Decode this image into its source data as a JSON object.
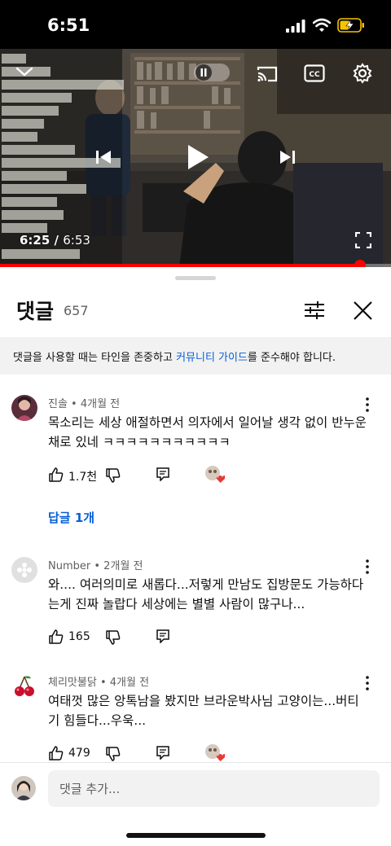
{
  "status_bar": {
    "time": "6:51"
  },
  "video": {
    "current_time": "6:25",
    "separator": " / ",
    "duration": "6:53",
    "progress": 0.92
  },
  "comments_panel": {
    "title": "댓글",
    "count": "657",
    "guideline_prefix": "댓글을 사용할 때는 타인을 존중하고 ",
    "guideline_link": "커뮤니티 가이드",
    "guideline_suffix": "를 준수해야 합니다."
  },
  "comments": [
    {
      "author": "진솔",
      "time": "4개월 전",
      "text": "목소리는 세상 애절하면서 의자에서 일어날 생각 없이 반누운채로 있네 ㅋㅋㅋㅋㅋㅋㅋㅋㅋㅋㅋ",
      "likes": "1.7천",
      "creator_heart": true,
      "replies_label": "답글 1개"
    },
    {
      "author": "Number",
      "time": "2개월 전",
      "text": "와.... 여러의미로 새롭다...저렇게 만남도 집방문도 가능하다는게 진짜 놀랍다 세상에는 별별 사람이 많구나...",
      "likes": "165",
      "creator_heart": false
    },
    {
      "author": "체리맛불닭",
      "time": "4개월 전",
      "text": "여태껏 많은 앙톡남을 봤지만 브라운박사님 고양이는...버티기 힘들다...우욱...",
      "likes": "479",
      "creator_heart": true
    }
  ],
  "meta_separator": " • ",
  "input": {
    "placeholder": "댓글 추가..."
  },
  "colors": {
    "accent_red": "#ff0000",
    "link_blue": "#065fd4",
    "muted_text": "#606060"
  },
  "icons": [
    "collapse-chevron-icon",
    "pause-icon",
    "cast-icon",
    "captions-icon",
    "settings-gear-icon",
    "previous-icon",
    "play-icon",
    "next-icon",
    "fullscreen-icon",
    "filter-icon",
    "close-icon",
    "like-icon",
    "dislike-icon",
    "reply-icon",
    "creator-heart-icon",
    "more-options-icon"
  ]
}
